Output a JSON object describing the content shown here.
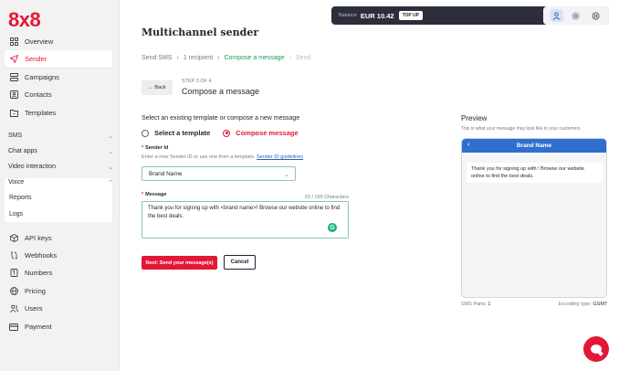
{
  "brand": {
    "logo": "8x8",
    "accent": "#e31837"
  },
  "sidebar": {
    "items": [
      {
        "label": "Overview",
        "icon": "grid-icon"
      },
      {
        "label": "Sender",
        "icon": "send-icon",
        "active": true
      },
      {
        "label": "Campaigns",
        "icon": "campaigns-icon"
      },
      {
        "label": "Contacts",
        "icon": "contacts-icon"
      },
      {
        "label": "Templates",
        "icon": "templates-icon"
      }
    ],
    "sections": [
      {
        "label": "SMS",
        "chevron": "⌄"
      },
      {
        "label": "Chat apps",
        "chevron": "⌄"
      },
      {
        "label": "Video interaction",
        "chevron": "⌄"
      },
      {
        "label": "Voice",
        "chevron": "⌃"
      }
    ],
    "voice_sub": [
      "Reports",
      "Logs"
    ],
    "bottom_items": [
      {
        "label": "API keys",
        "icon": "cube-icon"
      },
      {
        "label": "Webhooks",
        "icon": "webhook-icon"
      },
      {
        "label": "Numbers",
        "icon": "numbers-icon"
      },
      {
        "label": "Pricing",
        "icon": "globe-icon"
      },
      {
        "label": "Users",
        "icon": "users-icon"
      },
      {
        "label": "Payment",
        "icon": "card-icon"
      }
    ]
  },
  "topbar": {
    "balance_label": "Balance",
    "balance_value": "EUR 10.42",
    "topup_label": "TOP UP"
  },
  "main": {
    "title": "Multichannel sender",
    "breadcrumbs": [
      "Send SMS",
      "1 recipient",
      "Compose a message",
      "Send"
    ],
    "back_label": "← Back",
    "step": "STEP 3 OF 4",
    "step_title": "Compose a message",
    "prompt": "Select an existing template or compose a new message",
    "radio_template": "Select a template",
    "radio_compose": "Compose message",
    "sender_label": "Sender Id",
    "sender_help": "Enter a new Sender ID or use one from a template.",
    "sender_link": "Sender ID guidelines",
    "sender_value": "Brand Name",
    "message_label": "Message",
    "message_counter": "93 / 160 Characters",
    "message_value": "Thank you for signing up with <brand name>! Browse our website online to find the best deals.",
    "next_label": "Next: Send your message(s)",
    "cancel_label": "Cancel"
  },
  "preview": {
    "title": "Preview",
    "subtitle": "This is what your message may look like to your customers",
    "header": "Brand Name",
    "bubble": "Thank you for signing up with ! Browse our website online to find the best deals.",
    "sms_parts_label": "SMS Parts:",
    "sms_parts_value": "1",
    "encoding_label": "Encoding type:",
    "encoding_value": "GSM7"
  }
}
